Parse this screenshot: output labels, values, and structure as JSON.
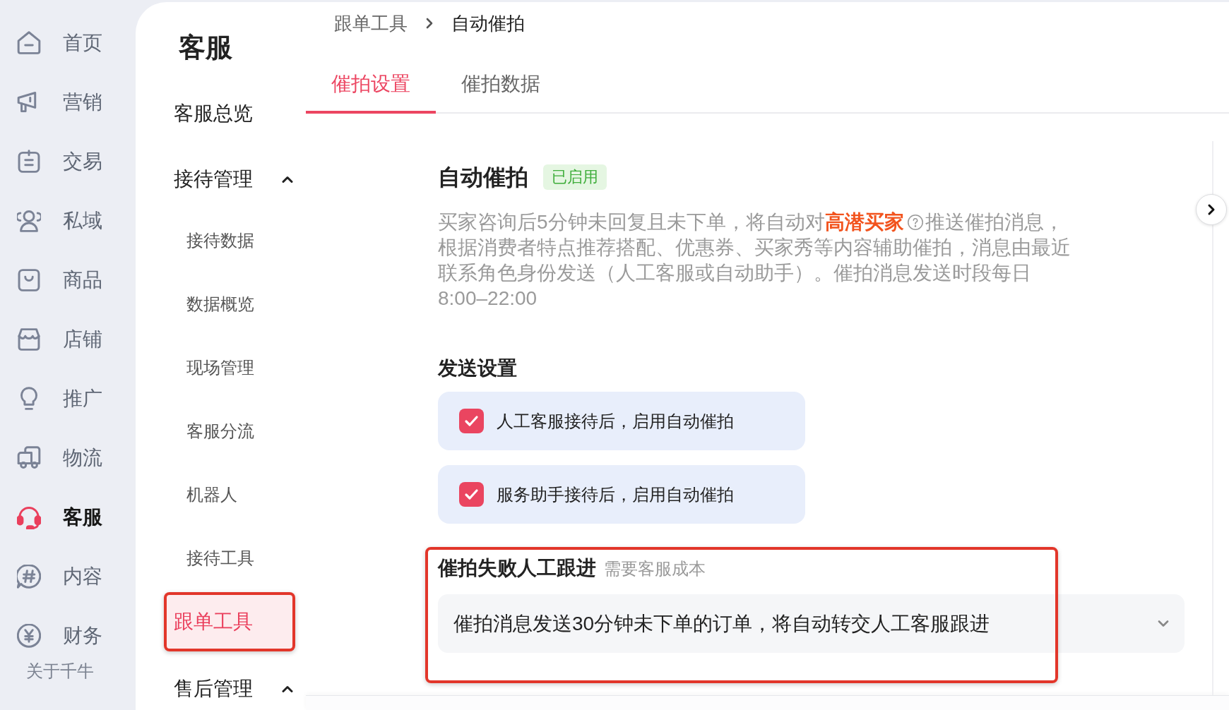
{
  "nav": {
    "items": [
      {
        "label": "首页",
        "selected": false
      },
      {
        "label": "营销",
        "selected": false
      },
      {
        "label": "交易",
        "selected": false
      },
      {
        "label": "私域",
        "selected": false
      },
      {
        "label": "商品",
        "selected": false
      },
      {
        "label": "店铺",
        "selected": false
      },
      {
        "label": "推广",
        "selected": false
      },
      {
        "label": "物流",
        "selected": false
      },
      {
        "label": "客服",
        "selected": true
      },
      {
        "label": "内容",
        "selected": false
      },
      {
        "label": "财务",
        "selected": false
      }
    ],
    "footer_link": "关于千牛"
  },
  "sub_nav": {
    "title": "客服",
    "items": [
      {
        "label": "客服总览",
        "kind": "link",
        "selected": false,
        "highlighted": false
      },
      {
        "label": "接待管理",
        "kind": "group",
        "expanded": true,
        "selected": false,
        "highlighted": false,
        "children": [
          {
            "label": "接待数据",
            "selected": false,
            "highlighted": false
          },
          {
            "label": "数据概览",
            "selected": false,
            "highlighted": false
          },
          {
            "label": "现场管理",
            "selected": false,
            "highlighted": false
          },
          {
            "label": "客服分流",
            "selected": false,
            "highlighted": false
          },
          {
            "label": "机器人",
            "selected": false,
            "highlighted": false
          },
          {
            "label": "接待工具",
            "selected": false,
            "highlighted": false
          },
          {
            "label": "跟单工具",
            "selected": true,
            "highlighted": true
          }
        ]
      },
      {
        "label": "售后管理",
        "kind": "group",
        "expanded": true,
        "selected": false,
        "highlighted": false
      }
    ]
  },
  "breadcrumb": [
    "跟单工具",
    "自动催拍"
  ],
  "tabs": [
    {
      "label": "催拍设置",
      "selected": true
    },
    {
      "label": "催拍数据",
      "selected": false
    }
  ],
  "feature": {
    "title": "自动催拍",
    "status": "已启用",
    "description": {
      "text_1": "买家咨询后5分钟未回复且未下单，将自动对**高潜买家**",
      "text_2": "推送催拍消息，",
      "text_3": "根据消费者特点推荐搭配、优惠券、买家秀等内容辅助催拍，消息由最近联系角色身份发送（人工客服或自动助手）。催拍消息发送时段每日8:00–22:00"
    }
  },
  "send_settings": {
    "title": "发送设置",
    "options": [
      {
        "label": "人工客服接待后，启用自动催拍",
        "checked": true
      },
      {
        "label": "服务助手接待后，启用自动催拍",
        "checked": true
      }
    ]
  },
  "followup": {
    "title": "催拍失败人工跟进",
    "note": "需要客服成本",
    "highlighted": true,
    "select": {
      "value": "催拍消息发送30分钟未下单的订单，将自动转交人工客服跟进"
    }
  }
}
